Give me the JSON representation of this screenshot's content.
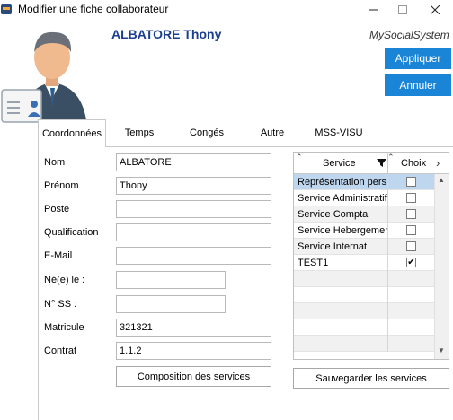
{
  "window": {
    "title": "Modifier une fiche collaborateur"
  },
  "header": {
    "employee_name": "ALBATORE Thony",
    "brand": "MySocialSystem",
    "apply_label": "Appliquer",
    "cancel_label": "Annuler"
  },
  "tabs": [
    {
      "label": "Coordonnées",
      "active": true
    },
    {
      "label": "Temps",
      "active": false
    },
    {
      "label": "Congés",
      "active": false
    },
    {
      "label": "Autre",
      "active": false
    },
    {
      "label": "MSS-VISU",
      "active": false
    }
  ],
  "form": {
    "fields": [
      {
        "label": "Nom",
        "value": "ALBATORE"
      },
      {
        "label": "Prénom",
        "value": "Thony"
      },
      {
        "label": "Poste",
        "value": ""
      },
      {
        "label": "Qualification",
        "value": ""
      },
      {
        "label": "E-Mail",
        "value": ""
      },
      {
        "label": "Né(e) le :",
        "value": ""
      },
      {
        "label": "N° SS :",
        "value": ""
      },
      {
        "label": "Matricule",
        "value": "321321"
      },
      {
        "label": "Contrat",
        "value": "1.1.2"
      }
    ],
    "composition_label": "Composition des services"
  },
  "services_grid": {
    "col_service": "Service",
    "col_choix": "Choix",
    "rows": [
      {
        "service": "Représentation pers",
        "checked": false,
        "selected": true
      },
      {
        "service": "Service Administratif",
        "checked": false,
        "selected": false
      },
      {
        "service": "Service Compta",
        "checked": false,
        "selected": false
      },
      {
        "service": "Service Hebergement",
        "checked": false,
        "selected": false
      },
      {
        "service": "Service Internat",
        "checked": false,
        "selected": false
      },
      {
        "service": "TEST1",
        "checked": true,
        "selected": false
      }
    ],
    "save_label": "Sauvegarder les services"
  },
  "colors": {
    "accent": "#1a85d6",
    "name_color": "#1b3f8f",
    "selected_row": "#bfd7ee"
  }
}
